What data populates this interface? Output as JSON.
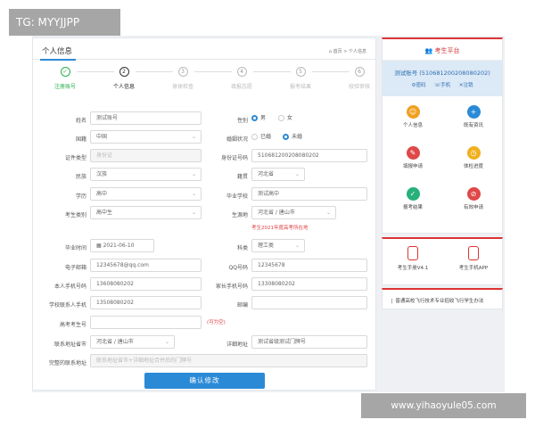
{
  "watermark_top": "TG: MYYJJPP",
  "watermark_bottom": "www.yihaoyule05.com",
  "main": {
    "title": "个人信息",
    "breadcrumb": "⌂ 首页 > 个人信息",
    "steps": [
      {
        "num": "✓",
        "label": "注册账号",
        "state": "done"
      },
      {
        "num": "2",
        "label": "个人信息",
        "state": "active"
      },
      {
        "num": "3",
        "label": "身体检查",
        "state": "todo"
      },
      {
        "num": "4",
        "label": "填报志愿",
        "state": "todo"
      },
      {
        "num": "5",
        "label": "报考结果",
        "state": "todo"
      },
      {
        "num": "6",
        "label": "校验审核",
        "state": "todo"
      }
    ]
  },
  "form": {
    "name_label": "姓名",
    "name_value": "测试账号",
    "gender_label": "性别",
    "gender_male": "男",
    "gender_female": "女",
    "nationality_label": "国籍",
    "nationality_value": "中国",
    "marital_label": "婚姻状况",
    "marital_yes": "已婚",
    "marital_no": "未婚",
    "idtype_label": "证件类型",
    "idtype_value": "身份证",
    "idno_label": "身份证号码",
    "idno_value": "510681200208080202",
    "ethnic_label": "民族",
    "ethnic_value": "汉族",
    "origin_label": "籍贯",
    "origin_value": "河北省",
    "edu_label": "学历",
    "edu_value": "高中",
    "school_label": "毕业学校",
    "school_value": "测试高中",
    "category_label": "考生类别",
    "category_value": "高中生",
    "birthplace_label": "生源地",
    "birthplace_value": "河北省 / 唐山市",
    "birthplace_note": "考生2021年度高考所在地",
    "gradtime_label": "毕业时间",
    "gradtime_value": "2021-06-10",
    "subject_label": "科类",
    "subject_value": "理工类",
    "email_label": "电子邮箱",
    "email_value": "12345678@qq.com",
    "qq_label": "QQ号码",
    "qq_value": "12345678",
    "phone_label": "本人手机号码",
    "phone_value": "13608080202",
    "parent_phone_label": "家长手机号码",
    "parent_phone_value": "13308080202",
    "school_contact_label": "学校联系人手机",
    "school_contact_value": "13508080202",
    "postcode_label": "邮编",
    "postcode_value": "",
    "exam_no_label": "高考考生号",
    "exam_no_value": "",
    "exam_no_note": "(可为空)",
    "address_label": "联系地址省市",
    "address_value": "河北省 / 唐山市",
    "detail_label": "详细地址",
    "detail_value": "测试省级测试门牌号",
    "full_address_label": "完整的联系地址",
    "full_address_value": "联系地址省市+详细地址合并后的门牌号",
    "submit_label": "确认修改"
  },
  "sidebar": {
    "title": "考生平台",
    "account": "测试账号 (510681200208080202)",
    "links": [
      "⚙密码",
      "☏手机",
      "✕注销"
    ],
    "tiles": [
      {
        "icon": "☺",
        "label": "个人信息",
        "color": "#f0a020"
      },
      {
        "icon": "+",
        "label": "既有资讯",
        "color": "#2b8ad6"
      },
      {
        "icon": "✎",
        "label": "填报申请",
        "color": "#e04848"
      },
      {
        "icon": "◷",
        "label": "体检进度",
        "color": "#f0b020"
      },
      {
        "icon": "✓",
        "label": "报考结果",
        "color": "#27b07a"
      },
      {
        "icon": "⊘",
        "label": "有效申请",
        "color": "#e04848"
      }
    ],
    "downloads": [
      "考生手册V4.1",
      "考生手机APP"
    ],
    "notice": "普通高校飞行技术专业招收飞行学生办法"
  }
}
